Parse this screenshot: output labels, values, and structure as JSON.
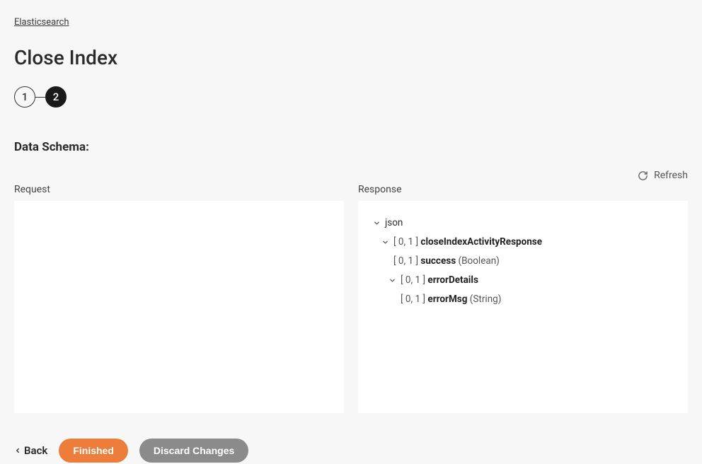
{
  "breadcrumb": "Elasticsearch",
  "title": "Close Index",
  "steps": {
    "step1": "1",
    "step2": "2"
  },
  "section_title": "Data Schema:",
  "refresh_label": "Refresh",
  "request_label": "Request",
  "response_label": "Response",
  "tree": {
    "root_label": "json",
    "n1_card": "[ 0, 1 ]",
    "n1_name": "closeIndexActivityResponse",
    "n2_card": "[ 0, 1 ]",
    "n2_name": "success",
    "n2_type": "(Boolean)",
    "n3_card": "[ 0, 1 ]",
    "n3_name": "errorDetails",
    "n4_card": "[ 0, 1 ]",
    "n4_name": "errorMsg",
    "n4_type": "(String)"
  },
  "footer": {
    "back": "Back",
    "finished": "Finished",
    "discard": "Discard Changes"
  }
}
